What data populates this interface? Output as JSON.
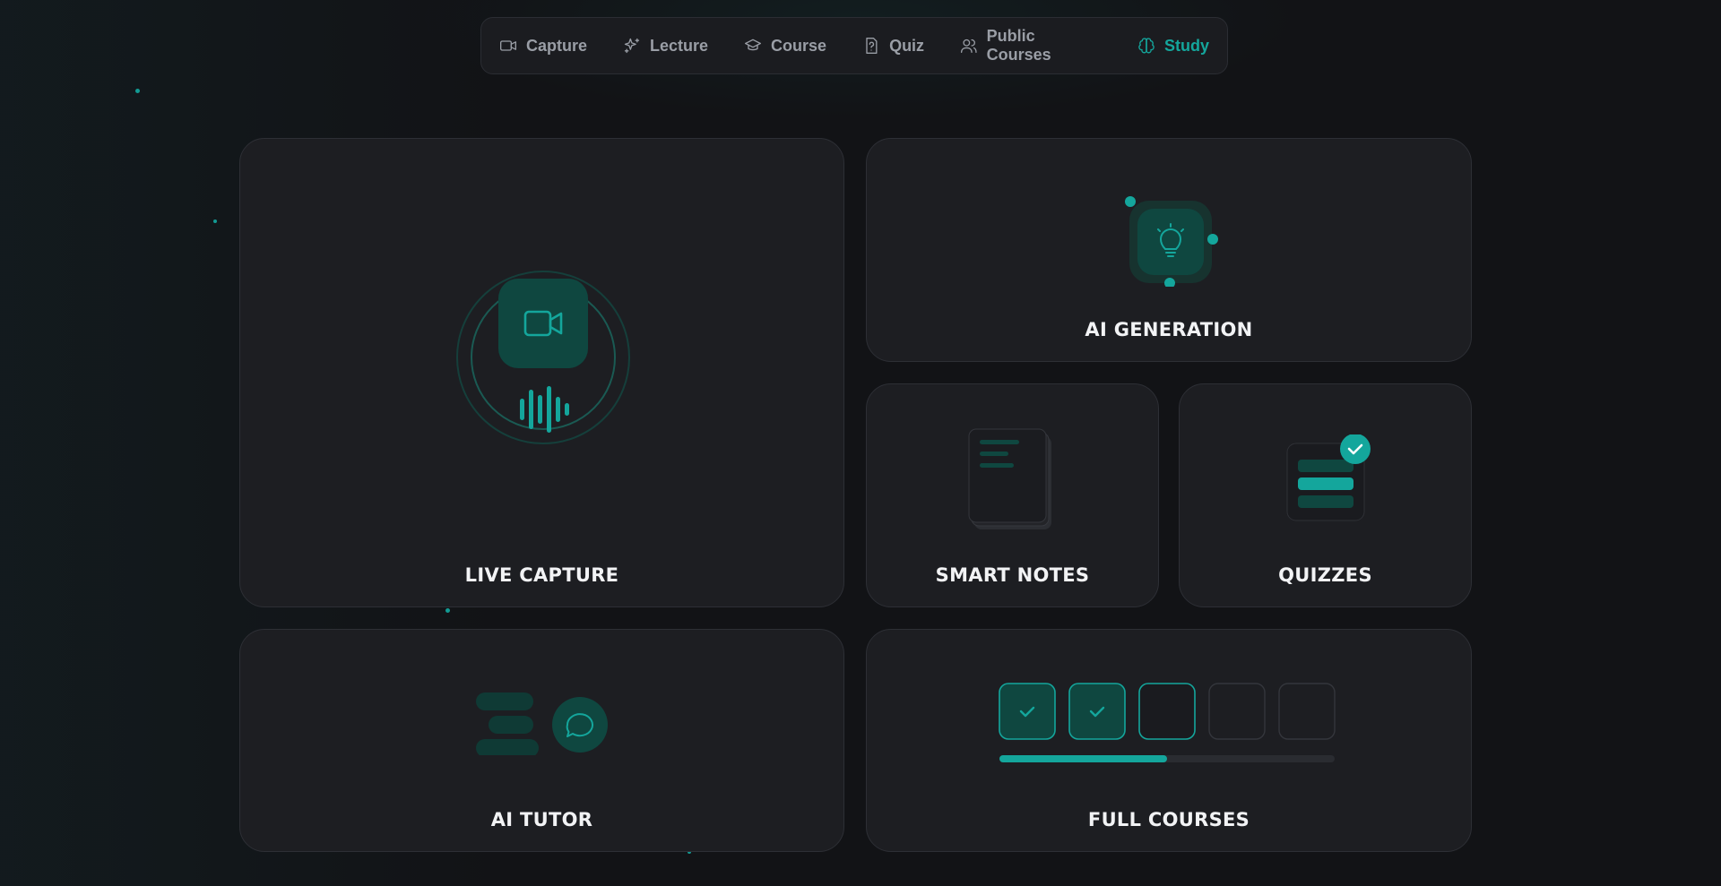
{
  "nav": {
    "items": [
      {
        "label": "Capture",
        "icon": "video-icon",
        "active": false
      },
      {
        "label": "Lecture",
        "icon": "sparkles-icon",
        "active": false
      },
      {
        "label": "Course",
        "icon": "graduation-cap-icon",
        "active": false
      },
      {
        "label": "Quiz",
        "icon": "question-file-icon",
        "active": false
      },
      {
        "label": "Public Courses",
        "icon": "users-icon",
        "active": false
      },
      {
        "label": "Study",
        "icon": "brain-icon",
        "active": true
      }
    ]
  },
  "cards": {
    "live_capture": {
      "title": "LIVE CAPTURE",
      "icon": "video-camera-icon"
    },
    "ai_generation": {
      "title": "AI GENERATION",
      "icon": "lightbulb-icon"
    },
    "smart_notes": {
      "title": "SMART NOTES",
      "icon": "notes-stack-icon"
    },
    "quizzes": {
      "title": "QUIZZES",
      "icon": "checkmark-icon"
    },
    "ai_tutor": {
      "title": "AI TUTOR",
      "icon": "chat-bubble-icon"
    },
    "full_courses": {
      "title": "FULL COURSES",
      "progress": 0.5,
      "modules_total": 5,
      "modules_done": 2,
      "modules_current": 3
    }
  },
  "colors": {
    "accent": "#14a69c",
    "accent_dark": "#0f4740",
    "background": "#121316",
    "card": "#1d1e22"
  }
}
